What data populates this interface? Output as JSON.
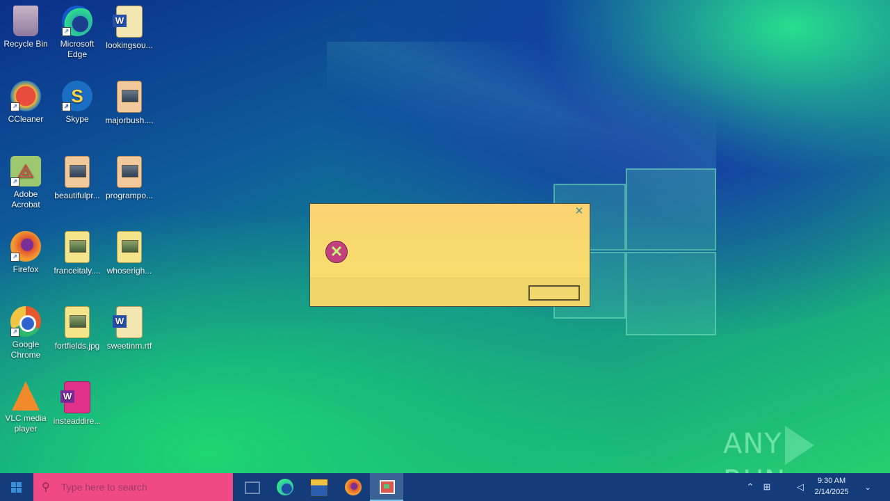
{
  "desktop": {
    "icons": [
      {
        "label": "Recycle Bin"
      },
      {
        "label": "Microsoft Edge"
      },
      {
        "label": "lookingsou..."
      },
      {
        "label": "CCleaner"
      },
      {
        "label": "Skype"
      },
      {
        "label": "majorbush...."
      },
      {
        "label": "Adobe Acrobat"
      },
      {
        "label": "beautifulpr..."
      },
      {
        "label": "programpo..."
      },
      {
        "label": "Firefox"
      },
      {
        "label": "franceitaly...."
      },
      {
        "label": "whoserigh..."
      },
      {
        "label": "Google Chrome"
      },
      {
        "label": "fortfields.jpg"
      },
      {
        "label": "sweetinm.rtf"
      },
      {
        "label": "VLC media player"
      },
      {
        "label": "insteaddire..."
      }
    ]
  },
  "dialog": {
    "message": "",
    "ok_label": "",
    "close_glyph": "✕"
  },
  "watermark": {
    "left": "ANY",
    "right": "RUN"
  },
  "taskbar": {
    "search_placeholder": "Type here to search",
    "clock_time": "9:30 AM",
    "clock_date": "2/14/2025"
  },
  "colors": {
    "taskbar": "#143c7a",
    "search_box": "#f04a86",
    "dialog": "#fbd66e"
  }
}
